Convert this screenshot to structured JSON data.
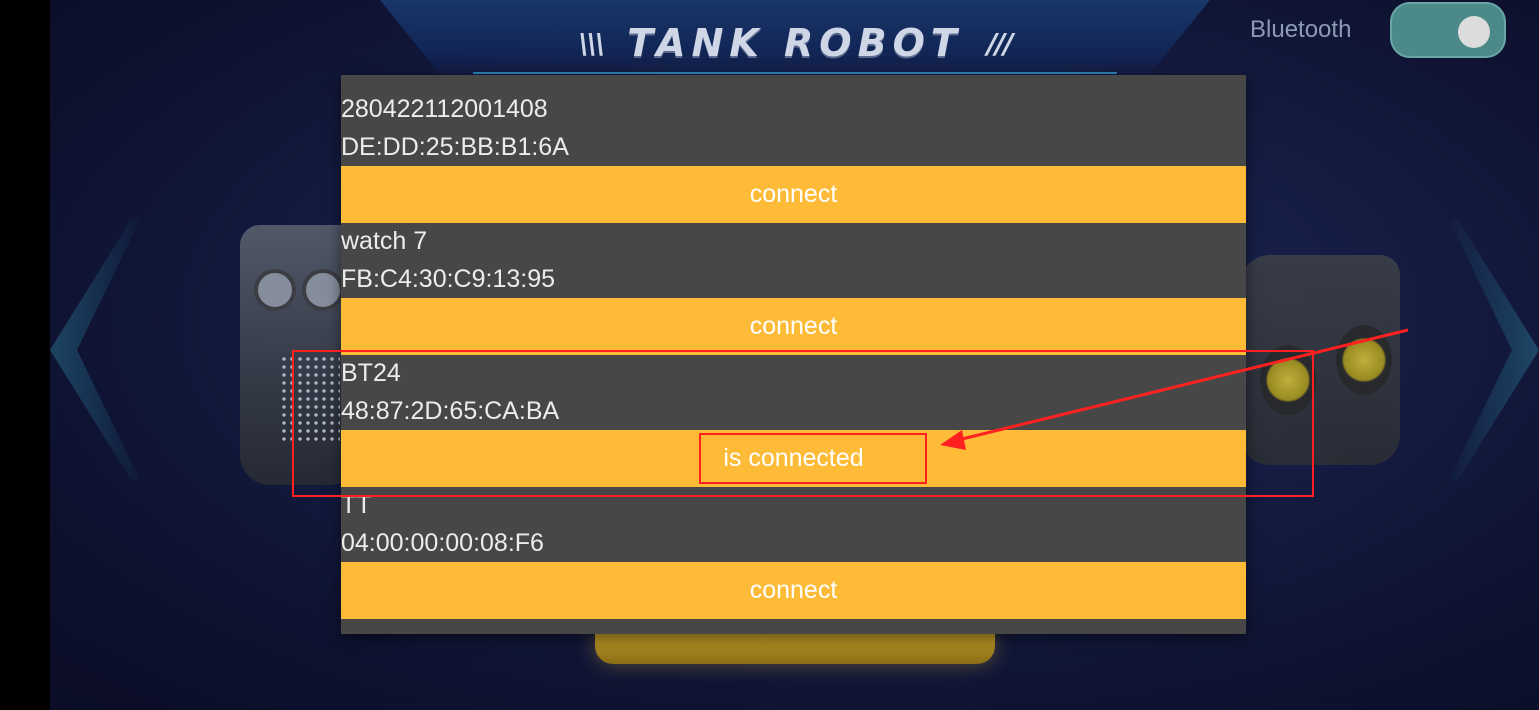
{
  "header": {
    "title": "TANK ROBOT",
    "decor_left": "\\\\\\",
    "decor_right": "///"
  },
  "bluetooth": {
    "label": "Bluetooth",
    "enabled": true
  },
  "dialog": {
    "devices": [
      {
        "name": "280422112001408",
        "address": "DE:DD:25:BB:B1:6A",
        "button_label": "connect"
      },
      {
        "name": "watch 7",
        "address": "FB:C4:30:C9:13:95",
        "button_label": "connect"
      },
      {
        "name": "BT24",
        "address": "48:87:2D:65:CA:BA",
        "button_label": "is connected"
      },
      {
        "name": "TT",
        "address": "04:00:00:00:08:F6",
        "button_label": "connect"
      }
    ]
  },
  "colors": {
    "button": "#fdbb38",
    "dialog_bg": "#474747",
    "annotation": "#ff2020",
    "toggle_on": "#4c8a8a"
  }
}
